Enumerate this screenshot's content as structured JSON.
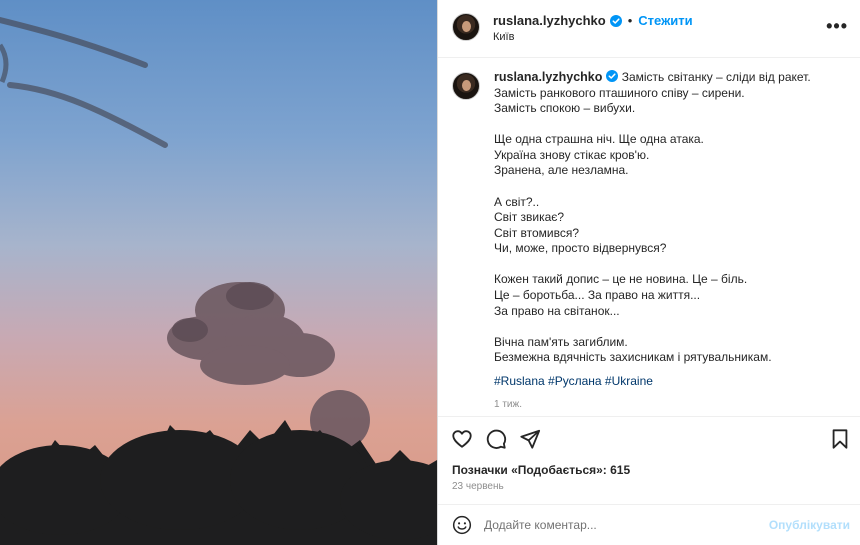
{
  "header": {
    "username": "ruslana.lyzhychko",
    "separator": "•",
    "follow_label": "Стежити",
    "location": "Київ",
    "more_label": "•••"
  },
  "caption": {
    "username": "ruslana.lyzhychko",
    "first_line": " Замість світанку – сліди від ракет.",
    "lines_a": [
      "Замість ранкового пташиного співу – сирени.",
      "Замість спокою – вибухи."
    ],
    "lines_b": [
      "Ще одна страшна ніч. Ще одна атака.",
      "Україна знову стікає кров'ю.",
      "Зранена, але незламна."
    ],
    "lines_c": [
      "А світ?..",
      "Світ звикає?",
      "Світ втомився?",
      "Чи, може, просто відвернувся?"
    ],
    "lines_d": [
      "Кожен такий допис – це не новина. Це – біль.",
      "Це – боротьба... За право на життя...",
      "За право на світанок..."
    ],
    "lines_e": [
      "Вічна пам'ять загиблим.",
      "Безмежна вдячність захисникам і рятувальникам."
    ],
    "hashtags": "#Ruslana #Руслана #Ukraine",
    "time_ago": "1 тиж."
  },
  "likes_text": "Позначки «Подобається»: 615",
  "date_text": "23 червень",
  "comment": {
    "placeholder": "Додайте коментар...",
    "post_label": "Опублікувати"
  },
  "colors": {
    "accent": "#0095f6",
    "verified": "#0095f6",
    "post_disabled": "#b2dffc"
  }
}
